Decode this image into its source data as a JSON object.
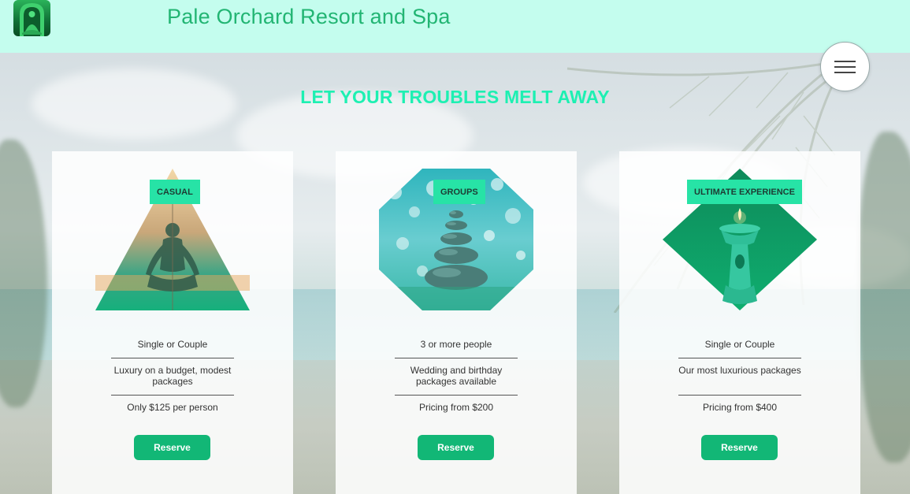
{
  "header": {
    "site_title": "Pale Orchard Resort and Spa",
    "logo_icon": "meditation-logo-icon"
  },
  "hero": {
    "headline": "LET YOUR TROUBLES MELT AWAY",
    "menu_icon": "hamburger-menu-icon"
  },
  "colors": {
    "header_bg": "#c4fdee",
    "title": "#22b573",
    "headline": "#1df0b2",
    "badge": "#27e3a6",
    "button": "#12b776"
  },
  "cards": [
    {
      "badge": "CASUAL",
      "shape": "triangle",
      "image": "meditating-person-sunset",
      "line1": "Single or Couple",
      "line2": "Luxury on a budget, modest packages",
      "line3": "Only $125 per person",
      "button": "Reserve"
    },
    {
      "badge": "GROUPS",
      "shape": "octagon",
      "image": "stacked-stones-bokeh",
      "line1": "3 or more people",
      "line2": "Wedding and birthday packages available",
      "line3": "Pricing from $200",
      "button": "Reserve"
    },
    {
      "badge": "ULTIMATE EXPERIENCE",
      "shape": "diamond",
      "image": "candle-oil-burner",
      "line1": "Single or Couple",
      "line2": "Our most luxurious packages",
      "line3": "Pricing from $400",
      "button": "Reserve"
    }
  ]
}
